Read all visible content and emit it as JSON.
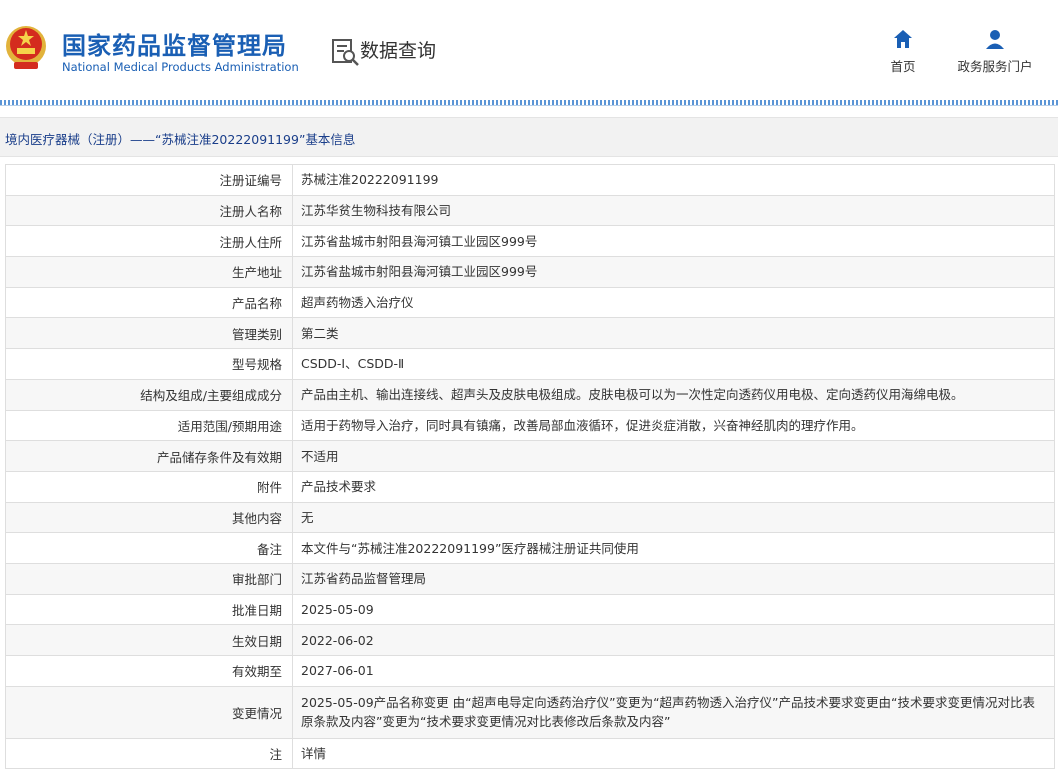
{
  "header": {
    "title": "国家药品监督管理局",
    "subtitle": "National Medical Products Administration",
    "query_title": "数据查询",
    "nav": {
      "home": "首页",
      "portal": "政务服务门户"
    }
  },
  "breadcrumb": "境内医疗器械（注册）——“苏械注准20222091199”基本信息",
  "rows": [
    {
      "label": "注册证编号",
      "value": "苏械注准20222091199"
    },
    {
      "label": "注册人名称",
      "value": "江苏华贫生物科技有限公司"
    },
    {
      "label": "注册人住所",
      "value": "江苏省盐城市射阳县海河镇工业园区999号"
    },
    {
      "label": "生产地址",
      "value": "江苏省盐城市射阳县海河镇工业园区999号"
    },
    {
      "label": "产品名称",
      "value": "超声药物透入治疗仪"
    },
    {
      "label": "管理类别",
      "value": "第二类"
    },
    {
      "label": "型号规格",
      "value": "CSDD-Ⅰ、CSDD-Ⅱ"
    },
    {
      "label": "结构及组成/主要组成成分",
      "value": "产品由主机、输出连接线、超声头及皮肤电极组成。皮肤电极可以为一次性定向透药仪用电极、定向透药仪用海绵电极。"
    },
    {
      "label": "适用范围/预期用途",
      "value": "适用于药物导入治疗，同时具有镇痛，改善局部血液循环，促进炎症消散，兴奋神经肌肉的理疗作用。"
    },
    {
      "label": "产品储存条件及有效期",
      "value": "不适用"
    },
    {
      "label": "附件",
      "value": "产品技术要求"
    },
    {
      "label": "其他内容",
      "value": "无"
    },
    {
      "label": "备注",
      "value": "本文件与“苏械注准20222091199”医疗器械注册证共同使用"
    },
    {
      "label": "审批部门",
      "value": "江苏省药品监督管理局"
    },
    {
      "label": "批准日期",
      "value": "2025-05-09"
    },
    {
      "label": "生效日期",
      "value": "2022-06-02"
    },
    {
      "label": "有效期至",
      "value": "2027-06-01"
    },
    {
      "label": "变更情况",
      "value": "2025-05-09产品名称变更 由“超声电导定向透药治疗仪”变更为“超声药物透入治疗仪”产品技术要求变更由“技术要求变更情况对比表原条款及内容”变更为“技术要求变更情况对比表修改后条款及内容”"
    },
    {
      "label": "注",
      "value": "详情"
    }
  ],
  "colors": {
    "brand": "#1a5fb4",
    "crumb_bg": "#f2f2f2",
    "row_alt": "#f7f7f7"
  },
  "icons": [
    "national-emblem-icon",
    "data-query-icon",
    "home-icon",
    "user-icon"
  ]
}
